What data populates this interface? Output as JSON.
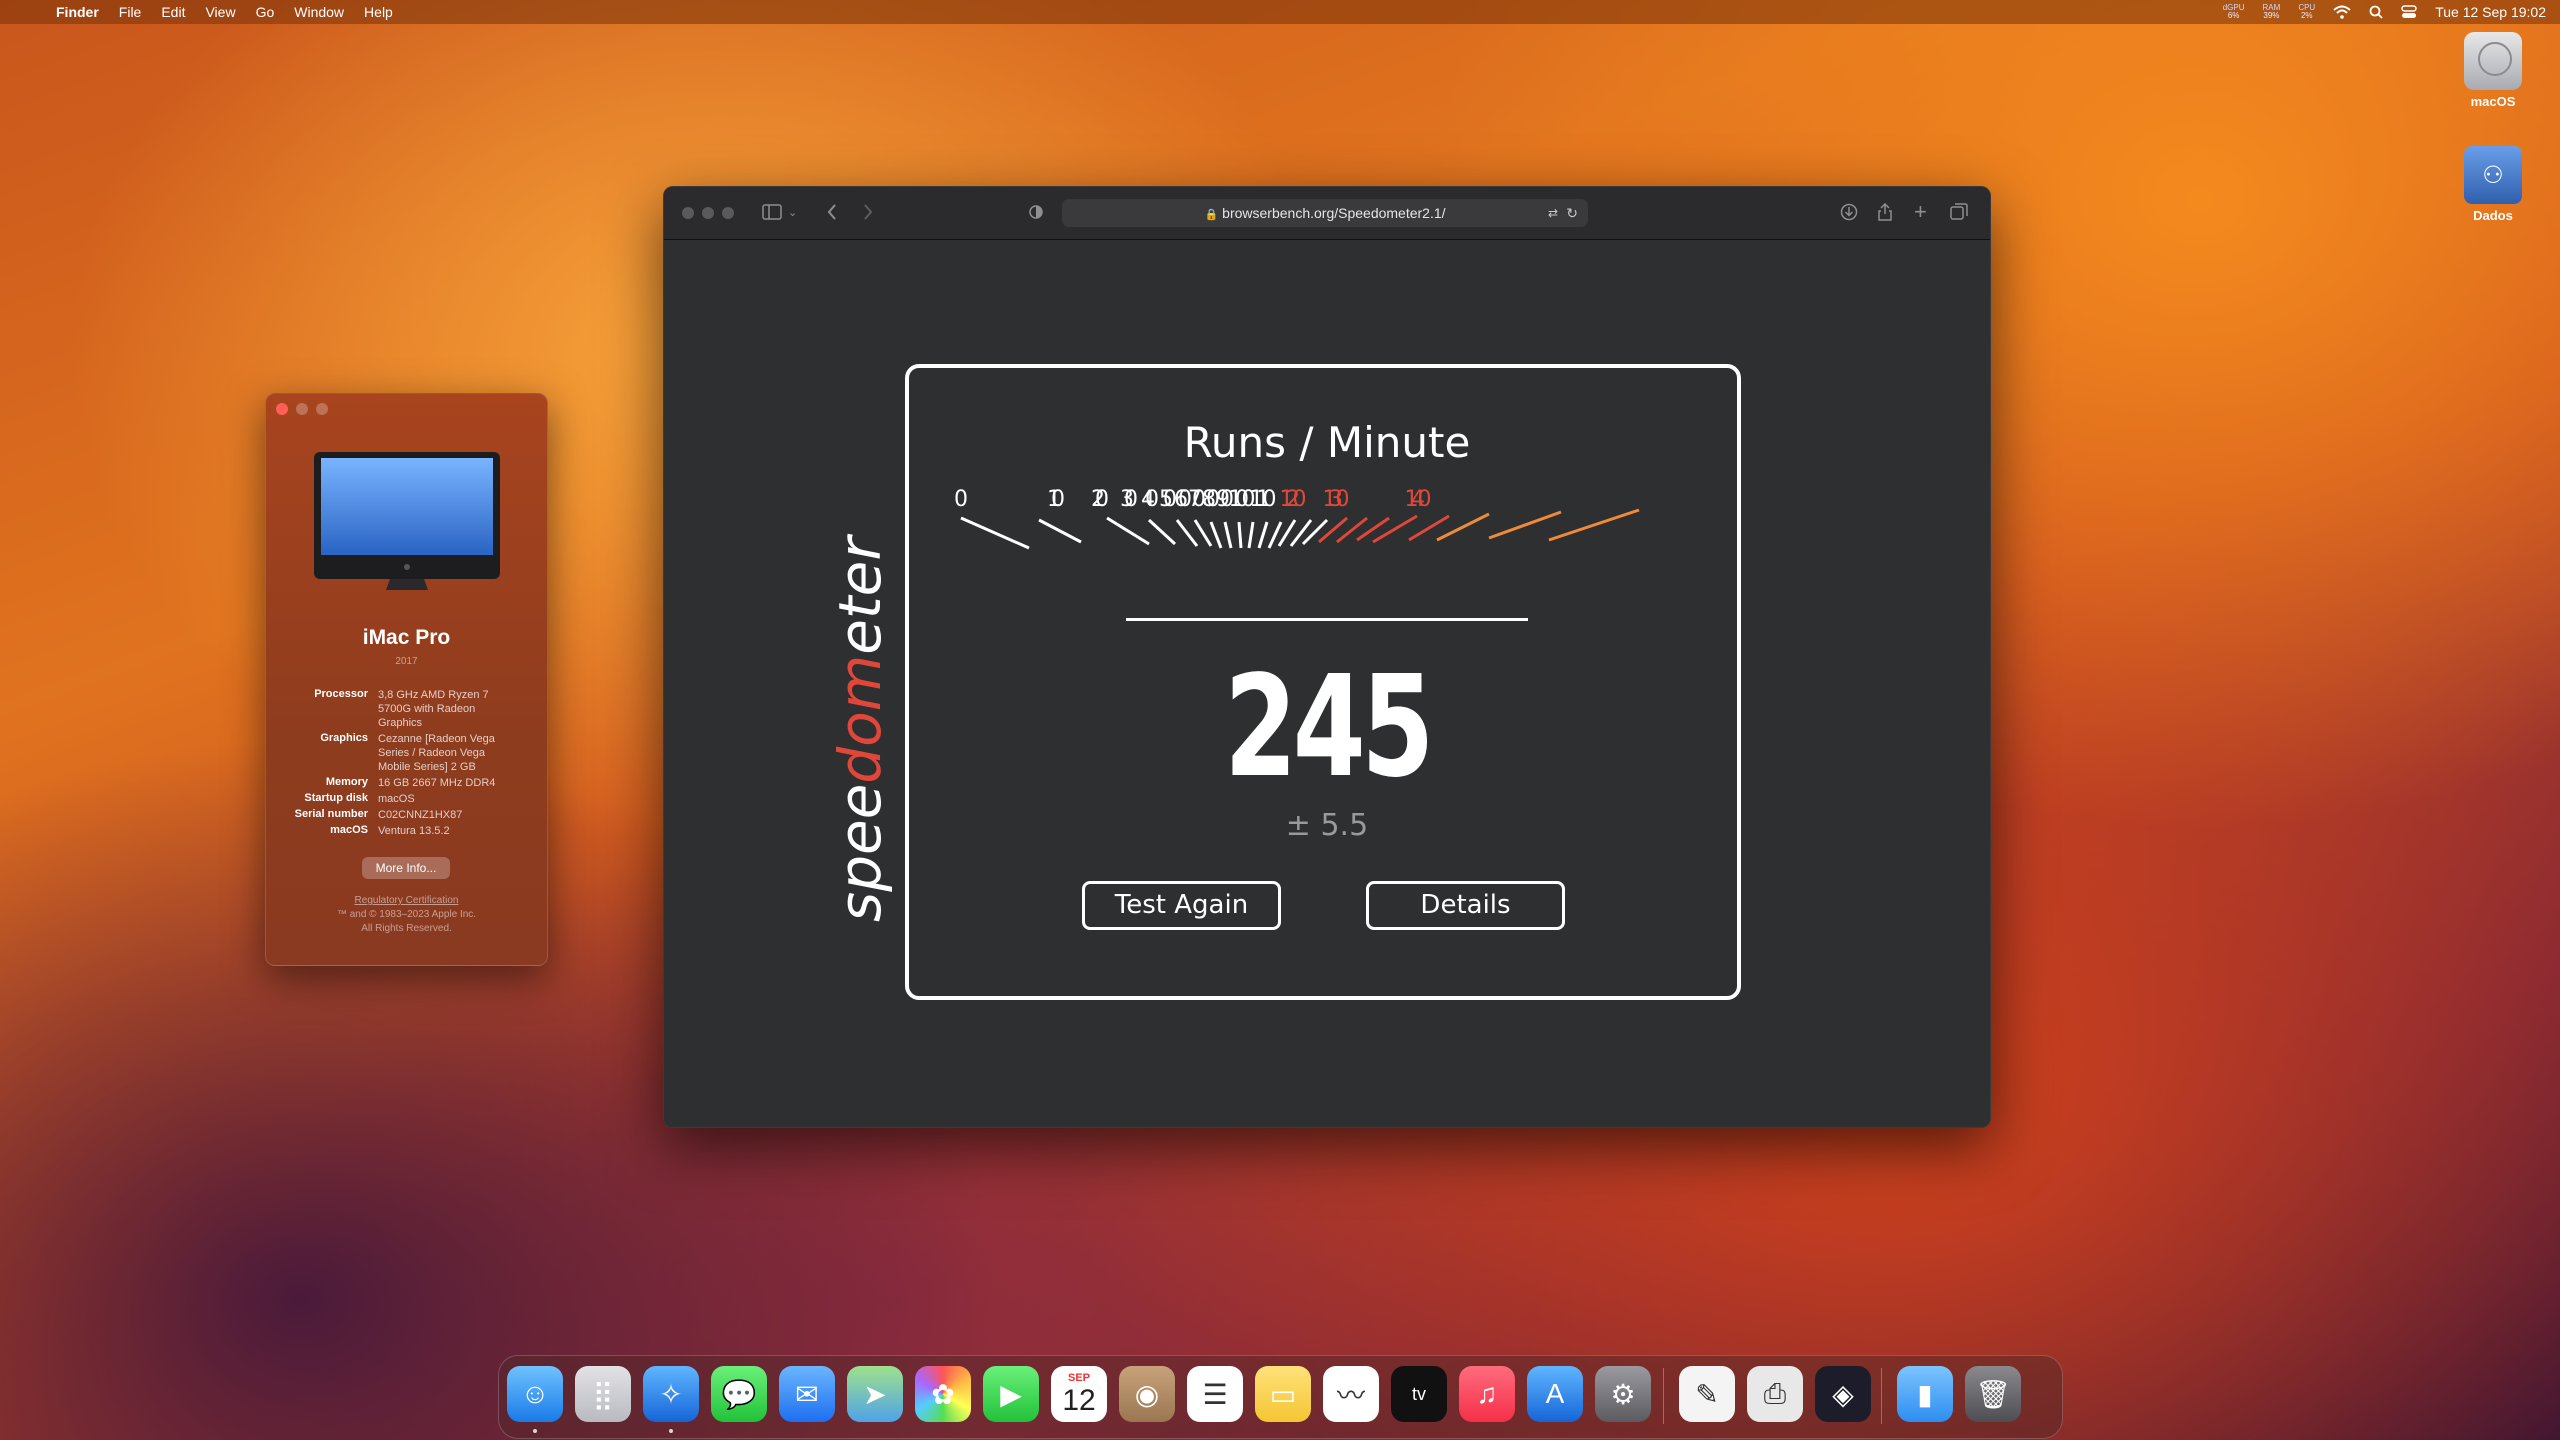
{
  "menubar": {
    "app": "Finder",
    "items": [
      "File",
      "Edit",
      "View",
      "Go",
      "Window",
      "Help"
    ],
    "stats": [
      {
        "label": "dGPU",
        "value": "6%"
      },
      {
        "label": "RAM",
        "value": "39%"
      },
      {
        "label": "CPU",
        "value": "2%"
      }
    ],
    "clock": "Tue 12 Sep  19:02"
  },
  "desktop": {
    "icons": [
      {
        "label": "macOS",
        "icon": "hard-disk-icon"
      },
      {
        "label": "Dados",
        "icon": "network-share-icon"
      }
    ]
  },
  "about": {
    "model": "iMac Pro",
    "year": "2017",
    "specs": [
      {
        "key": "Processor",
        "value": "3,8 GHz AMD Ryzen 7 5700G with Radeon Graphics"
      },
      {
        "key": "Graphics",
        "value": "Cezanne [Radeon Vega Series / Radeon Vega Mobile Series] 2 GB"
      },
      {
        "key": "Memory",
        "value": "16 GB 2667 MHz DDR4"
      },
      {
        "key": "Startup disk",
        "value": "macOS"
      },
      {
        "key": "Serial number",
        "value": "C02CNNZ1HX87"
      },
      {
        "key": "macOS",
        "value": "Ventura 13.5.2"
      }
    ],
    "more_info": "More Info...",
    "regulatory": "Regulatory Certification",
    "copyright1": "™ and © 1983–2023 Apple Inc.",
    "copyright2": "All Rights Reserved."
  },
  "safari": {
    "url": "browserbench.org/Speedometer2.1/"
  },
  "speedometer": {
    "logo_text": "speedometer",
    "title": "Runs / Minute",
    "gauge_labels": [
      "0",
      "10",
      "20",
      "30",
      "40",
      "50",
      "60",
      "70",
      "80",
      "90",
      "100",
      "110",
      "120",
      "130",
      "140"
    ],
    "score": "245",
    "margin": "± 5.5",
    "test_again": "Test Again",
    "details": "Details"
  },
  "dock": {
    "apps": [
      "Finder",
      "Launchpad",
      "Safari",
      "Messages",
      "Mail",
      "Maps",
      "Photos",
      "FaceTime",
      "Calendar",
      "Contacts",
      "Reminders",
      "Notes",
      "Freeform",
      "TV",
      "Music",
      "App Store",
      "System Settings",
      "TextEdit",
      "Preview",
      "DaVinci Resolve",
      "Downloads",
      "Trash"
    ],
    "calendar_month": "SEP",
    "calendar_day": "12"
  }
}
